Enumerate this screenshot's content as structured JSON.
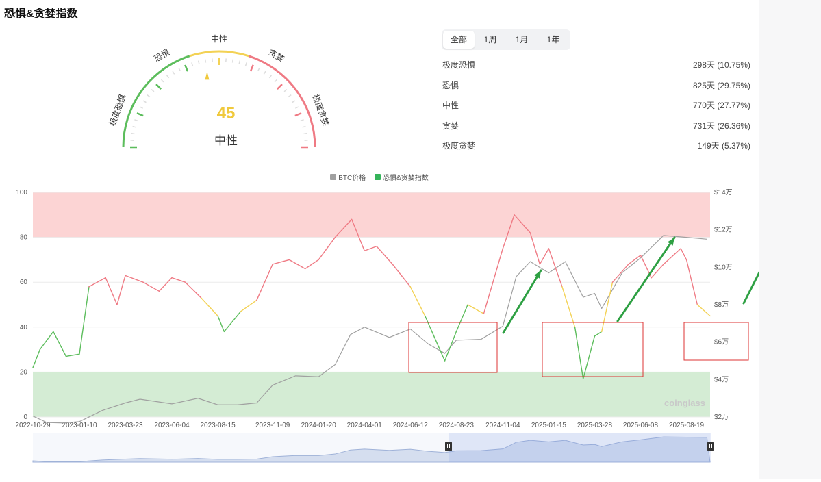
{
  "page": {
    "title": "恐惧&贪婪指数"
  },
  "gauge": {
    "value": "45",
    "status": "中性",
    "labels": {
      "extreme_fear": "极度恐惧",
      "fear": "恐惧",
      "neutral": "中性",
      "greed": "贪婪",
      "extreme_greed": "极度贪婪"
    },
    "colors": {
      "fear": "#5cbd5c",
      "neutral": "#f3d255",
      "greed": "#ef7a84",
      "pointer": "#f0c93c"
    }
  },
  "range_tabs": [
    "全部",
    "1周",
    "1月",
    "1年"
  ],
  "active_tab": "全部",
  "stats": [
    {
      "label": "极度恐惧",
      "value": "298天 (10.75%)"
    },
    {
      "label": "恐惧",
      "value": "825天 (29.75%)"
    },
    {
      "label": "中性",
      "value": "770天 (27.77%)"
    },
    {
      "label": "贪婪",
      "value": "731天 (26.36%)"
    },
    {
      "label": "极度贪婪",
      "value": "149天 (5.37%)"
    }
  ],
  "watermark": "coinglass",
  "chart_data": {
    "type": "line",
    "legend": [
      {
        "name": "BTC价格",
        "color": "#a0a0a0"
      },
      {
        "name": "恐惧&贪婪指数",
        "color": "#35b45a"
      }
    ],
    "x_ticks": [
      "2022-10-29",
      "2023-01-10",
      "2023-03-23",
      "2023-06-04",
      "2023-08-15",
      "2023-11-09",
      "2024-01-20",
      "2024-04-01",
      "2024-06-12",
      "2024-08-23",
      "2024-11-04",
      "2025-01-15",
      "2025-03-28",
      "2025-06-08",
      "2025-08-19"
    ],
    "y_left": {
      "ticks": [
        "0",
        "20",
        "40",
        "60",
        "80",
        "100"
      ],
      "range": [
        0,
        100
      ]
    },
    "y_right": {
      "ticks": [
        "$2万",
        "$4万",
        "$6万",
        "$8万",
        "$10万",
        "$12万",
        "$14万"
      ],
      "range": [
        20000,
        140000
      ]
    },
    "zones": [
      {
        "from": 80,
        "to": 100,
        "color": "#fcd4d4"
      },
      {
        "from": 0,
        "to": 20,
        "color": "#d4ecd4"
      }
    ],
    "series": [
      {
        "name": "BTC价格",
        "axis": "right",
        "x": [
          "2022-10-29",
          "2022-11-20",
          "2022-12-15",
          "2023-01-10",
          "2023-02-15",
          "2023-03-23",
          "2023-04-15",
          "2023-06-04",
          "2023-07-15",
          "2023-08-15",
          "2023-09-15",
          "2023-10-15",
          "2023-11-09",
          "2023-12-15",
          "2024-01-20",
          "2024-02-15",
          "2024-03-10",
          "2024-04-01",
          "2024-05-10",
          "2024-06-12",
          "2024-07-10",
          "2024-08-05",
          "2024-08-23",
          "2024-10-01",
          "2024-11-04",
          "2024-11-25",
          "2024-12-17",
          "2025-01-15",
          "2025-02-10",
          "2025-03-10",
          "2025-03-28",
          "2025-04-08",
          "2025-05-10",
          "2025-06-08",
          "2025-07-14",
          "2025-08-19",
          "2025-09-20"
        ],
        "values": [
          20500,
          17000,
          16800,
          17500,
          23500,
          27500,
          29500,
          27000,
          30000,
          26500,
          26500,
          27500,
          37000,
          42000,
          41500,
          48000,
          64000,
          68000,
          62500,
          67000,
          59000,
          54000,
          61000,
          61500,
          68500,
          95000,
          103000,
          97000,
          103000,
          84000,
          86000,
          78000,
          97000,
          105000,
          117000,
          116000,
          115000
        ]
      },
      {
        "name": "恐惧&贪婪指数",
        "axis": "left",
        "x": [
          "2022-10-29",
          "2022-11-09",
          "2022-11-30",
          "2022-12-20",
          "2023-01-10",
          "2023-01-25",
          "2023-02-20",
          "2023-03-10",
          "2023-03-23",
          "2023-04-20",
          "2023-05-15",
          "2023-06-04",
          "2023-06-25",
          "2023-07-20",
          "2023-08-15",
          "2023-08-25",
          "2023-09-20",
          "2023-10-15",
          "2023-11-09",
          "2023-12-05",
          "2023-12-30",
          "2024-01-20",
          "2024-02-15",
          "2024-03-12",
          "2024-04-01",
          "2024-04-20",
          "2024-05-15",
          "2024-06-12",
          "2024-07-05",
          "2024-08-05",
          "2024-08-23",
          "2024-09-10",
          "2024-10-05",
          "2024-11-04",
          "2024-11-22",
          "2024-12-17",
          "2025-01-01",
          "2025-01-15",
          "2025-02-05",
          "2025-02-25",
          "2025-03-10",
          "2025-03-28",
          "2025-04-08",
          "2025-04-25",
          "2025-05-20",
          "2025-06-08",
          "2025-06-25",
          "2025-07-14",
          "2025-08-10",
          "2025-08-19",
          "2025-09-05",
          "2025-09-25"
        ],
        "values": [
          22,
          30,
          38,
          27,
          28,
          58,
          62,
          50,
          63,
          60,
          56,
          62,
          60,
          53,
          45,
          38,
          47,
          52,
          68,
          70,
          66,
          70,
          80,
          88,
          74,
          76,
          68,
          58,
          45,
          25,
          38,
          50,
          46,
          75,
          90,
          82,
          68,
          75,
          58,
          40,
          17,
          36,
          38,
          60,
          68,
          72,
          62,
          68,
          75,
          70,
          50,
          45
        ]
      }
    ],
    "annotations": "3 red rectangles marking fear periods, 3 green upward trend arrows"
  }
}
